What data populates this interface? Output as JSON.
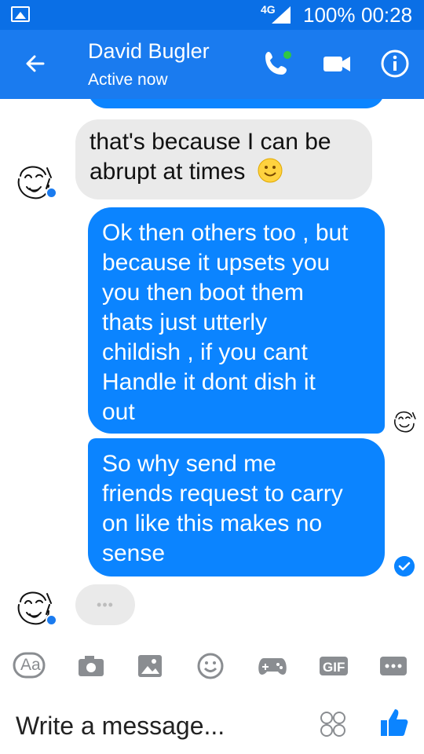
{
  "status": {
    "network": "4G",
    "battery": "100%",
    "time": "00:28"
  },
  "header": {
    "contact_name": "David Bugler",
    "status": "Active now"
  },
  "messages": [
    {
      "direction": "incoming",
      "text_line1": "that's because I can be",
      "text_line2": "abrupt at times"
    },
    {
      "direction": "outgoing",
      "lines": [
        "Ok then others too , but",
        "because it upsets you",
        "you then boot them",
        "thats just utterly",
        "childish , if you cant",
        "Handle it dont dish it",
        "out"
      ]
    },
    {
      "direction": "outgoing",
      "lines": [
        "So why send me",
        "friends request to carry",
        "on like this makes no",
        "sense"
      ]
    }
  ],
  "typing": {
    "dots": "•••"
  },
  "toolbar": {
    "text_label": "Aa",
    "gif_label": "GIF"
  },
  "composer": {
    "placeholder": "Write a message..."
  },
  "colors": {
    "appbar": "#1a7bef",
    "statusbar": "#0a6fe6",
    "outgoing_bubble": "#0b84ff",
    "incoming_bubble": "#eaeaea",
    "active_dot": "#31c742"
  },
  "icons": [
    "back-icon",
    "phone-icon",
    "video-icon",
    "info-icon",
    "camera-icon",
    "image-icon",
    "emoji-icon",
    "game-controller-icon",
    "gif-icon",
    "more-icon",
    "stickers-icon",
    "like-icon"
  ]
}
